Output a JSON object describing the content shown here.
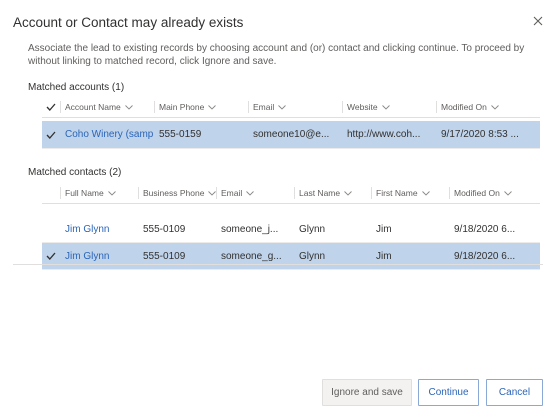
{
  "dialog": {
    "title": "Account or Contact may already exists",
    "description": "Associate the lead to existing records by choosing account and (or) contact and clicking continue. To proceed by without linking to matched record, click Ignore and save."
  },
  "accounts": {
    "label": "Matched accounts (1)",
    "columns": [
      "Account Name",
      "Main Phone",
      "Email",
      "Website",
      "Modified On"
    ],
    "rows": [
      {
        "selected": true,
        "cells": [
          "Coho Winery (sample)",
          "555-0159",
          "someone10@e...",
          "http://www.coh...",
          "9/17/2020 8:53 ..."
        ]
      }
    ]
  },
  "contacts": {
    "label": "Matched contacts (2)",
    "columns": [
      "Full Name",
      "Business Phone",
      "Email",
      "Last Name",
      "First Name",
      "Modified On"
    ],
    "rows": [
      {
        "selected": false,
        "cells": [
          "Jim Glynn",
          "555-0109",
          "someone_j...",
          "Glynn",
          "Jim",
          "9/18/2020 6..."
        ]
      },
      {
        "selected": true,
        "cells": [
          "Jim Glynn",
          "555-0109",
          "someone_g...",
          "Glynn",
          "Jim",
          "9/18/2020 6..."
        ]
      }
    ]
  },
  "buttons": {
    "ignore": "Ignore and save",
    "continue": "Continue",
    "cancel": "Cancel"
  },
  "colors": {
    "accent": "#2b65b8",
    "selected_row": "#bfd3ea"
  },
  "icons": {
    "close": "close-icon",
    "check": "checkmark-icon",
    "sort": "chevron-down-icon"
  }
}
